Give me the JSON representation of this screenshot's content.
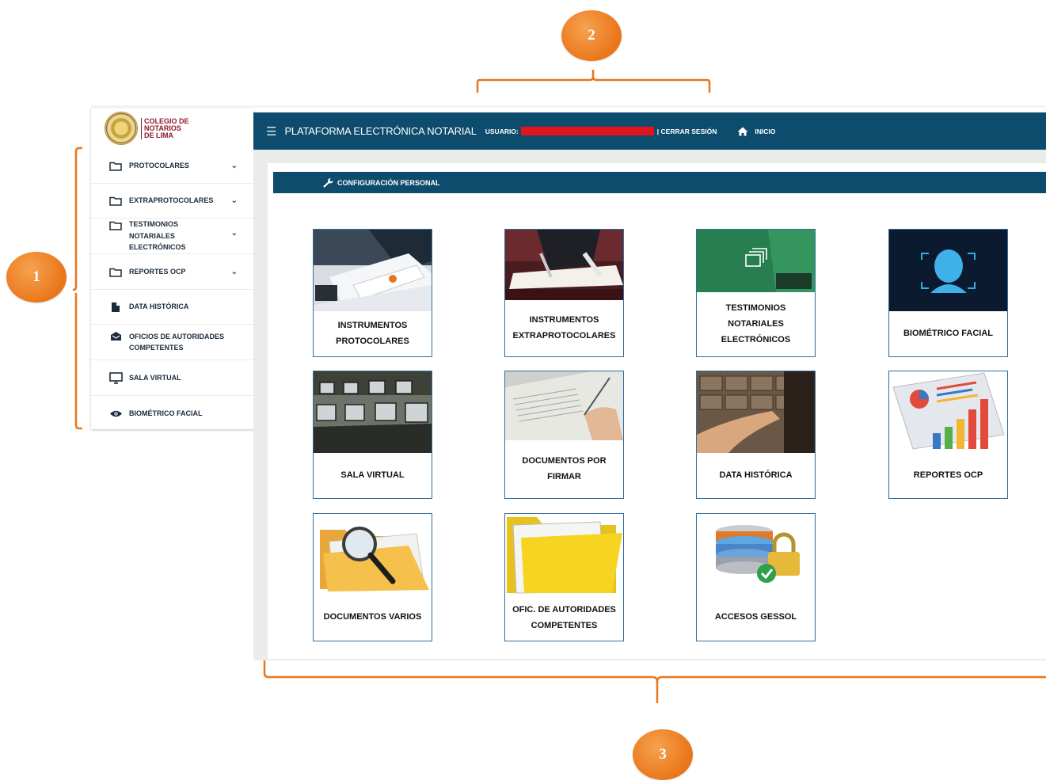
{
  "annotations": {
    "callout_1": "1",
    "callout_2": "2",
    "callout_3": "3"
  },
  "logo": {
    "line1": "COLEGIO DE",
    "line2": "NOTARIOS",
    "line3": "DE LIMA"
  },
  "sidebar": {
    "items": [
      {
        "label": "PROTOCOLARES",
        "icon": "folder-icon",
        "expandable": true
      },
      {
        "label": "EXTRAPROTOCOLARES",
        "icon": "folder-icon",
        "expandable": true
      },
      {
        "label": "TESTIMONIOS NOTARIALES ELECTRÓNICOS",
        "icon": "folder-icon",
        "expandable": true
      },
      {
        "label": "REPORTES OCP",
        "icon": "folder-icon",
        "expandable": true
      },
      {
        "label": "DATA HISTÓRICA",
        "icon": "file-icon",
        "expandable": false
      },
      {
        "label": "OFICIOS DE AUTORIDADES COMPETENTES",
        "icon": "envelope-open-icon",
        "expandable": false
      },
      {
        "label": "SALA VIRTUAL",
        "icon": "monitor-icon",
        "expandable": false
      },
      {
        "label": "BIOMÉTRICO FACIAL",
        "icon": "eye-icon",
        "expandable": false
      }
    ]
  },
  "header": {
    "title": "PLATAFORMA ELECTRÓNICA NOTARIAL",
    "user_label": "USUARIO:",
    "logout_label": "| CERRAR SESIÓN",
    "home_label": "INICIO"
  },
  "config": {
    "label": "CONFIGURACIÓN PERSONAL"
  },
  "tiles": [
    {
      "label": "INSTRUMENTOS PROTOCOLARES",
      "image": "document-signing-photo"
    },
    {
      "label": "INSTRUMENTOS EXTRAPROTOCOLARES",
      "image": "pen-signing-photo"
    },
    {
      "label": "TESTIMONIOS NOTARIALES ELECTRÓNICOS",
      "image": "digital-files-photo"
    },
    {
      "label": "BIOMÉTRICO FACIAL",
      "image": "face-scan-image"
    },
    {
      "label": "SALA VIRTUAL",
      "image": "computer-room-photo"
    },
    {
      "label": "DOCUMENTOS POR FIRMAR",
      "image": "hand-signing-photo"
    },
    {
      "label": "DATA HISTÓRICA",
      "image": "archive-drawer-photo"
    },
    {
      "label": "REPORTES OCP",
      "image": "reports-chart-image"
    },
    {
      "label": "DOCUMENTOS VARIOS",
      "image": "folder-magnifier-image"
    },
    {
      "label": "OFIC. DE AUTORIDADES COMPETENTES",
      "image": "yellow-folder-image"
    },
    {
      "label": "ACCESOS GESSOL",
      "image": "database-lock-image"
    }
  ],
  "colors": {
    "primary": "#0d4c6d",
    "accent": "#e9761b",
    "logo_red": "#8b1a2a",
    "tile_border": "#2f6f9f"
  }
}
